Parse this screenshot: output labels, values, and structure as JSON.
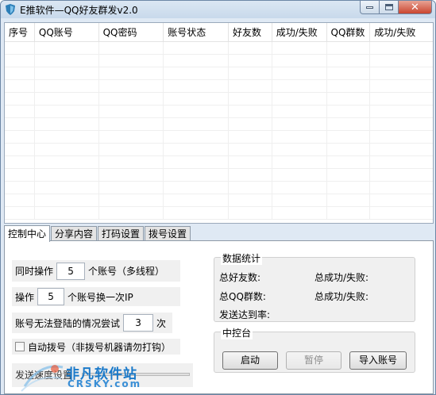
{
  "window": {
    "title": "E推软件—QQ好友群发v2.0",
    "controls": {
      "minimize": "minimize-icon",
      "maximize": "maximize-icon",
      "close": "close-icon"
    }
  },
  "table": {
    "columns": [
      "序号",
      "QQ账号",
      "QQ密码",
      "账号状态",
      "好友数",
      "成功/失败",
      "QQ群数",
      "成功/失败"
    ],
    "rows": []
  },
  "tabs": [
    {
      "label": "控制中心",
      "active": true
    },
    {
      "label": "分享内容",
      "active": false
    },
    {
      "label": "打码设置",
      "active": false
    },
    {
      "label": "拨号设置",
      "active": false
    }
  ],
  "control": {
    "concurrent": {
      "prefix": "同时操作",
      "value": "5",
      "suffix": "个账号（多线程）"
    },
    "switch_ip": {
      "prefix": "操作",
      "value": "5",
      "suffix": "个账号换一次IP"
    },
    "retry": {
      "prefix": "账号无法登陆的情况尝试",
      "value": "3",
      "suffix": "次"
    },
    "auto_dial": {
      "label": "自动拨号（非拨号机器请勿打钩）",
      "checked": false
    },
    "send_speed": {
      "label": "发送速度设置"
    }
  },
  "stats": {
    "title": "数据统计",
    "total_friends": "总好友数:",
    "total_success_fail_1": "总成功/失败:",
    "total_groups": "总QQ群数:",
    "total_success_fail_2": "总成功/失败:",
    "arrival_rate": "发送达到率:"
  },
  "console": {
    "title": "中控台",
    "start": "启动",
    "pause": "暂停",
    "import": "导入账号"
  },
  "watermark": {
    "cn": "非凡软件站",
    "en": "CRSKY.com"
  }
}
